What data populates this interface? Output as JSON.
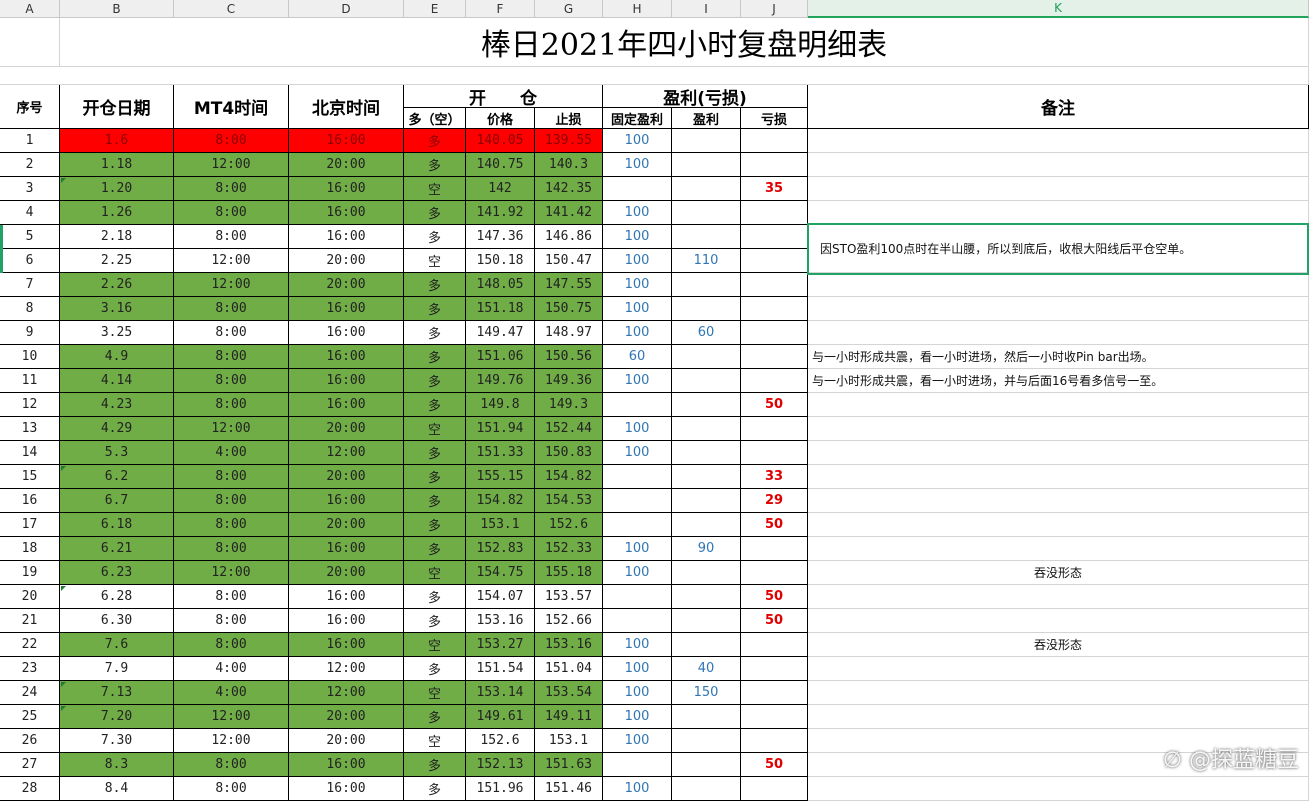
{
  "sheet_title": "棒日2021年四小时复盘明细表",
  "columns": [
    "A",
    "B",
    "C",
    "D",
    "E",
    "F",
    "G",
    "H",
    "I",
    "J",
    "K"
  ],
  "active_column": "K",
  "headers": {
    "seq": "序号",
    "open_date": "开仓日期",
    "mt4_time": "MT4时间",
    "beijing_time": "北京时间",
    "open_position": "开　　仓",
    "profit_loss": "盈利(亏损)",
    "remark": "备注",
    "direction": "多（空）",
    "price": "价格",
    "stop_loss": "止损",
    "fixed_profit": "固定盈利",
    "profit": "盈利",
    "loss": "亏损"
  },
  "rows": [
    {
      "seq": "1",
      "date": "1.6",
      "mt4": "8:00",
      "bj": "16:00",
      "dir": "多",
      "price": "140.05",
      "stop": "139.55",
      "fixed": "100",
      "profit": "",
      "loss": "",
      "note": "",
      "fill": "red"
    },
    {
      "seq": "2",
      "date": "1.18",
      "mt4": "12:00",
      "bj": "20:00",
      "dir": "多",
      "price": "140.75",
      "stop": "140.3",
      "fixed": "100",
      "profit": "",
      "loss": "",
      "note": "",
      "fill": "green"
    },
    {
      "seq": "3",
      "date": "1.20",
      "mt4": "8:00",
      "bj": "16:00",
      "dir": "空",
      "price": "142",
      "stop": "142.35",
      "fixed": "",
      "profit": "",
      "loss": "35",
      "note": "",
      "fill": "green"
    },
    {
      "seq": "4",
      "date": "1.26",
      "mt4": "8:00",
      "bj": "16:00",
      "dir": "多",
      "price": "141.92",
      "stop": "141.42",
      "fixed": "100",
      "profit": "",
      "loss": "",
      "note": "",
      "fill": "green"
    },
    {
      "seq": "5",
      "date": "2.18",
      "mt4": "8:00",
      "bj": "16:00",
      "dir": "多",
      "price": "147.36",
      "stop": "146.86",
      "fixed": "100",
      "profit": "",
      "loss": "",
      "note": "",
      "fill": "none"
    },
    {
      "seq": "6",
      "date": "2.25",
      "mt4": "12:00",
      "bj": "20:00",
      "dir": "空",
      "price": "150.18",
      "stop": "150.47",
      "fixed": "100",
      "profit": "110",
      "loss": "",
      "note": "",
      "fill": "none"
    },
    {
      "seq": "7",
      "date": "2.26",
      "mt4": "12:00",
      "bj": "20:00",
      "dir": "多",
      "price": "148.05",
      "stop": "147.55",
      "fixed": "100",
      "profit": "",
      "loss": "",
      "note": "",
      "fill": "green"
    },
    {
      "seq": "8",
      "date": "3.16",
      "mt4": "8:00",
      "bj": "16:00",
      "dir": "多",
      "price": "151.18",
      "stop": "150.75",
      "fixed": "100",
      "profit": "",
      "loss": "",
      "note": "",
      "fill": "green"
    },
    {
      "seq": "9",
      "date": "3.25",
      "mt4": "8:00",
      "bj": "16:00",
      "dir": "多",
      "price": "149.47",
      "stop": "148.97",
      "fixed": "100",
      "profit": "60",
      "loss": "",
      "note": "",
      "fill": "none"
    },
    {
      "seq": "10",
      "date": "4.9",
      "mt4": "8:00",
      "bj": "16:00",
      "dir": "多",
      "price": "151.06",
      "stop": "150.56",
      "fixed": "60",
      "profit": "",
      "loss": "",
      "note": "与一小时形成共震，看一小时进场，然后一小时收Pin bar出场。",
      "fill": "green"
    },
    {
      "seq": "11",
      "date": "4.14",
      "mt4": "8:00",
      "bj": "16:00",
      "dir": "多",
      "price": "149.76",
      "stop": "149.36",
      "fixed": "100",
      "profit": "",
      "loss": "",
      "note": "与一小时形成共震，看一小时进场，并与后面16号看多信号一至。",
      "fill": "green"
    },
    {
      "seq": "12",
      "date": "4.23",
      "mt4": "8:00",
      "bj": "16:00",
      "dir": "多",
      "price": "149.8",
      "stop": "149.3",
      "fixed": "",
      "profit": "",
      "loss": "50",
      "note": "",
      "fill": "green"
    },
    {
      "seq": "13",
      "date": "4.29",
      "mt4": "12:00",
      "bj": "20:00",
      "dir": "空",
      "price": "151.94",
      "stop": "152.44",
      "fixed": "100",
      "profit": "",
      "loss": "",
      "note": "",
      "fill": "green"
    },
    {
      "seq": "14",
      "date": "5.3",
      "mt4": "4:00",
      "bj": "12:00",
      "dir": "多",
      "price": "151.33",
      "stop": "150.83",
      "fixed": "100",
      "profit": "",
      "loss": "",
      "note": "",
      "fill": "green"
    },
    {
      "seq": "15",
      "date": "6.2",
      "mt4": "8:00",
      "bj": "20:00",
      "dir": "多",
      "price": "155.15",
      "stop": "154.82",
      "fixed": "",
      "profit": "",
      "loss": "33",
      "note": "",
      "fill": "green"
    },
    {
      "seq": "16",
      "date": "6.7",
      "mt4": "8:00",
      "bj": "16:00",
      "dir": "多",
      "price": "154.82",
      "stop": "154.53",
      "fixed": "",
      "profit": "",
      "loss": "29",
      "note": "",
      "fill": "green"
    },
    {
      "seq": "17",
      "date": "6.18",
      "mt4": "8:00",
      "bj": "20:00",
      "dir": "多",
      "price": "153.1",
      "stop": "152.6",
      "fixed": "",
      "profit": "",
      "loss": "50",
      "note": "",
      "fill": "green"
    },
    {
      "seq": "18",
      "date": "6.21",
      "mt4": "8:00",
      "bj": "16:00",
      "dir": "多",
      "price": "152.83",
      "stop": "152.33",
      "fixed": "100",
      "profit": "90",
      "loss": "",
      "note": "",
      "fill": "green"
    },
    {
      "seq": "19",
      "date": "6.23",
      "mt4": "12:00",
      "bj": "20:00",
      "dir": "空",
      "price": "154.75",
      "stop": "155.18",
      "fixed": "100",
      "profit": "",
      "loss": "",
      "note": "吞没形态",
      "fill": "green"
    },
    {
      "seq": "20",
      "date": "6.28",
      "mt4": "8:00",
      "bj": "16:00",
      "dir": "多",
      "price": "154.07",
      "stop": "153.57",
      "fixed": "",
      "profit": "",
      "loss": "50",
      "note": "",
      "fill": "none"
    },
    {
      "seq": "21",
      "date": "6.30",
      "mt4": "8:00",
      "bj": "16:00",
      "dir": "多",
      "price": "153.16",
      "stop": "152.66",
      "fixed": "",
      "profit": "",
      "loss": "50",
      "note": "",
      "fill": "none"
    },
    {
      "seq": "22",
      "date": "7.6",
      "mt4": "8:00",
      "bj": "16:00",
      "dir": "空",
      "price": "153.27",
      "stop": "153.16",
      "fixed": "100",
      "profit": "",
      "loss": "",
      "note": "吞没形态",
      "fill": "green"
    },
    {
      "seq": "23",
      "date": "7.9",
      "mt4": "4:00",
      "bj": "12:00",
      "dir": "多",
      "price": "151.54",
      "stop": "151.04",
      "fixed": "100",
      "profit": "40",
      "loss": "",
      "note": "",
      "fill": "none"
    },
    {
      "seq": "24",
      "date": "7.13",
      "mt4": "4:00",
      "bj": "12:00",
      "dir": "空",
      "price": "153.14",
      "stop": "153.54",
      "fixed": "100",
      "profit": "150",
      "loss": "",
      "note": "",
      "fill": "green"
    },
    {
      "seq": "25",
      "date": "7.20",
      "mt4": "12:00",
      "bj": "20:00",
      "dir": "多",
      "price": "149.61",
      "stop": "149.11",
      "fixed": "100",
      "profit": "",
      "loss": "",
      "note": "",
      "fill": "green"
    },
    {
      "seq": "26",
      "date": "7.30",
      "mt4": "12:00",
      "bj": "20:00",
      "dir": "空",
      "price": "152.6",
      "stop": "153.1",
      "fixed": "100",
      "profit": "",
      "loss": "",
      "note": "",
      "fill": "none"
    },
    {
      "seq": "27",
      "date": "8.3",
      "mt4": "8:00",
      "bj": "16:00",
      "dir": "多",
      "price": "152.13",
      "stop": "151.63",
      "fixed": "",
      "profit": "",
      "loss": "50",
      "note": "",
      "fill": "green"
    },
    {
      "seq": "28",
      "date": "8.4",
      "mt4": "8:00",
      "bj": "16:00",
      "dir": "多",
      "price": "151.96",
      "stop": "151.46",
      "fixed": "100",
      "profit": "",
      "loss": "",
      "note": "",
      "fill": "none"
    }
  ],
  "merged_note": "因STO盈利100点时在半山腰，所以到底后，收根大阳线后平仓空单。",
  "watermark": "@探蓝糖豆",
  "colors": {
    "green": "#70ad47",
    "red": "#ff0000",
    "blue_text": "#2f75b5",
    "loss_text": "#e00000",
    "selection": "#21a366"
  }
}
